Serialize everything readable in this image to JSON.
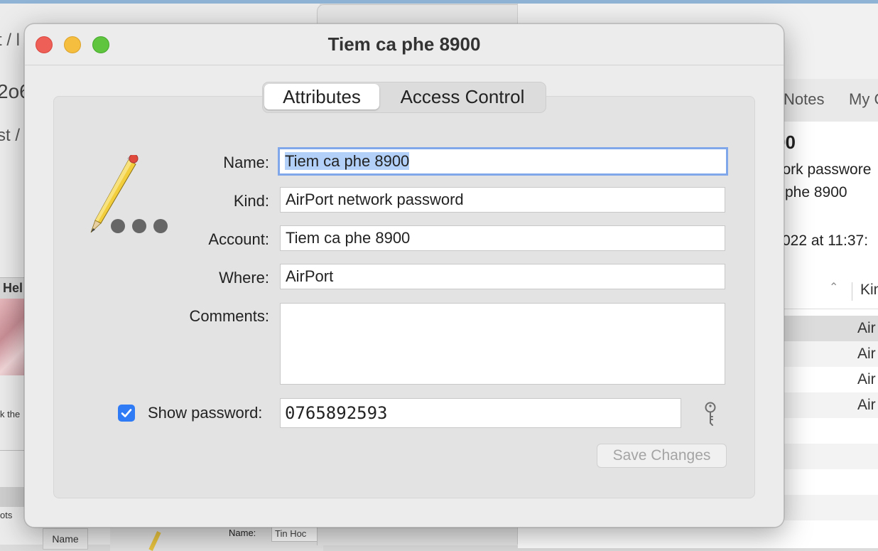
{
  "background": {
    "left_window": {
      "crumb1": "t / l",
      "code": "2o6",
      "crumb2": "st /",
      "hel": "Hel",
      "k_the": "k the",
      "ots": "ots",
      "name_col": "Name",
      "sub_name_label": "Name:",
      "sub_name_value": "Tin Hoc"
    },
    "right_window": {
      "tab_notes": "Notes",
      "tab_my": "My C",
      "title_fragment": "00",
      "kind_fragment": "vork passwore",
      "name_fragment": "phe 8900",
      "date_fragment": "022 at 11:37:",
      "col_kind": "Kin",
      "rows": [
        "Air",
        "Air",
        "Air",
        "Air"
      ]
    }
  },
  "dialog": {
    "title": "Tiem ca phe 8900",
    "tabs": [
      "Attributes",
      "Access Control"
    ],
    "selected_tab": "Attributes",
    "fields": {
      "name_label": "Name:",
      "name_value": "Tiem ca phe 8900",
      "kind_label": "Kind:",
      "kind_value": "AirPort network password",
      "account_label": "Account:",
      "account_value": "Tiem ca phe 8900",
      "where_label": "Where:",
      "where_value": "AirPort",
      "comments_label": "Comments:",
      "comments_value": ""
    },
    "show_password": {
      "label": "Show password:",
      "checked": true,
      "value": "0765892593"
    },
    "save_button": "Save Changes",
    "icons": {
      "item_icon": "pencil-with-dots-icon",
      "key": "key-icon",
      "checkmark": "checkmark-icon"
    },
    "colors": {
      "accent": "#2f7bf6",
      "focus_ring": "#80a7ea",
      "selection": "#b3d1f8",
      "close": "#ee5f57",
      "minimize": "#f5be3f",
      "zoom": "#5fc53f"
    }
  }
}
